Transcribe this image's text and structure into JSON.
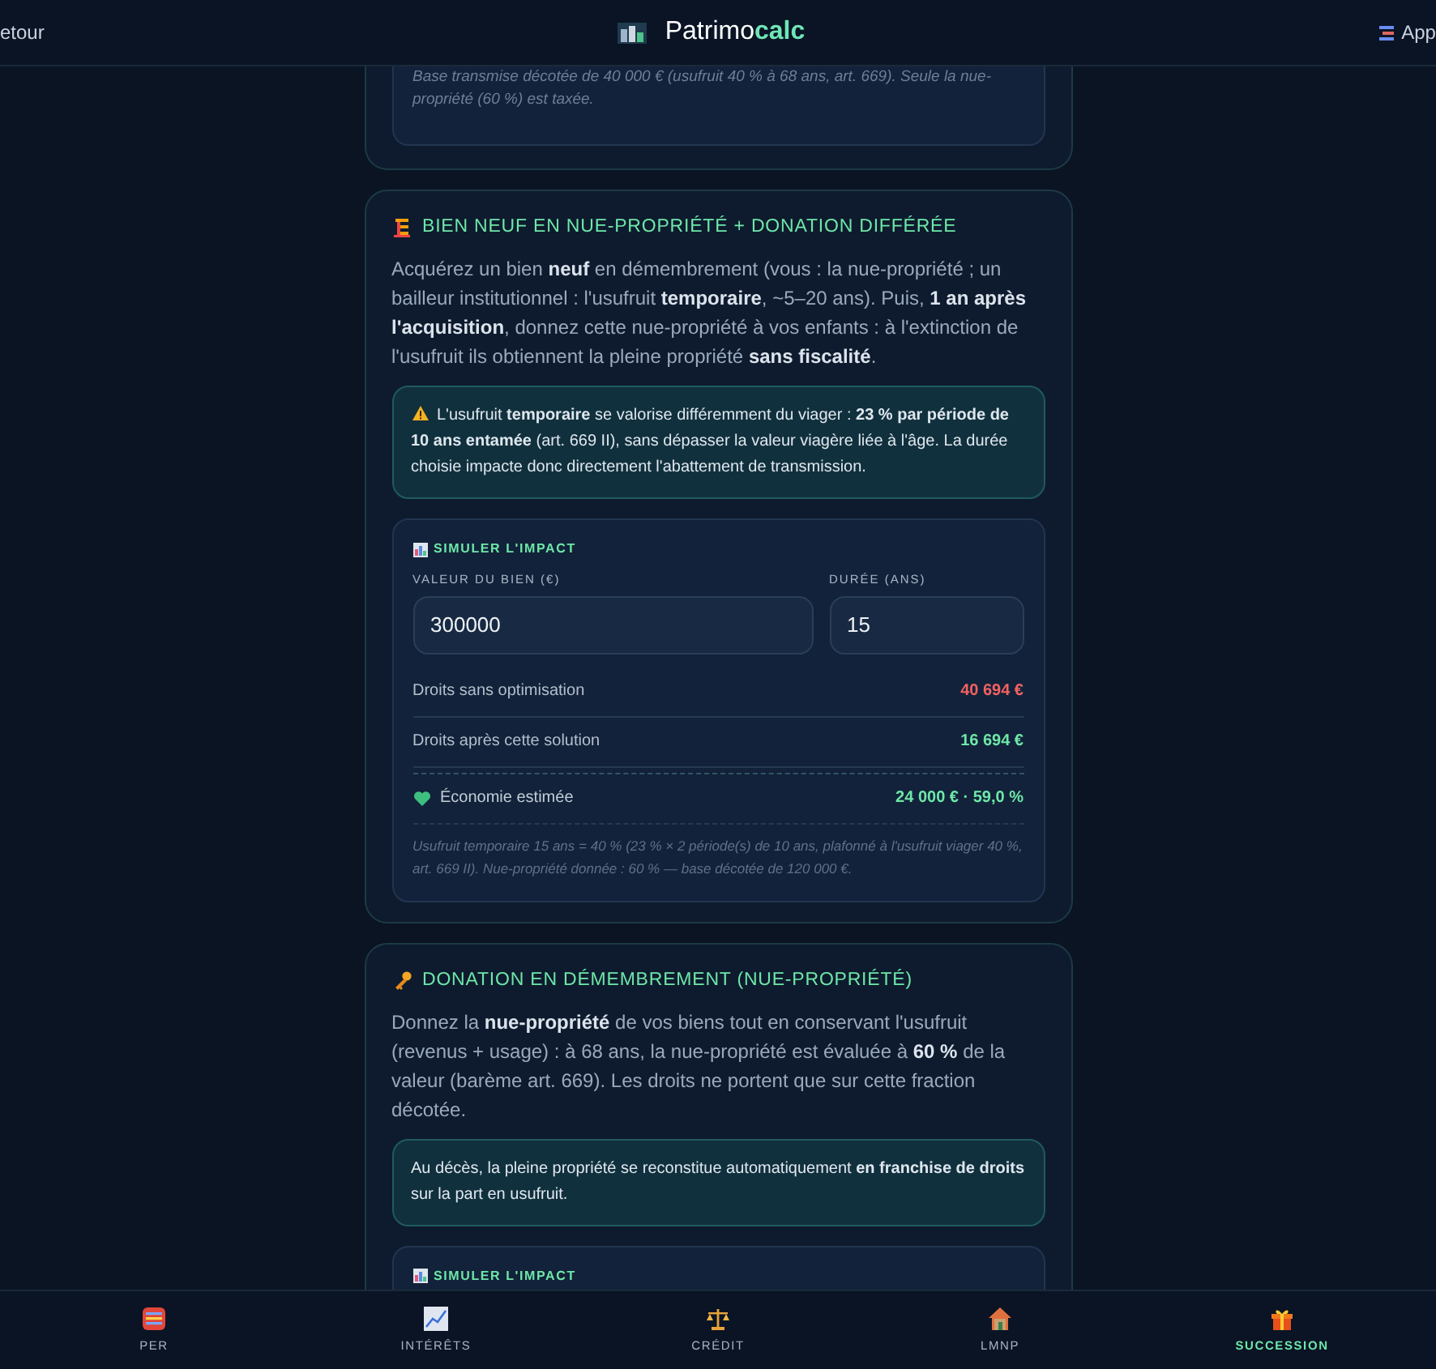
{
  "header": {
    "back_link": "etour",
    "title_main": "Patrimo",
    "title_accent": "calc",
    "apps_link": "App"
  },
  "cards": [
    {
      "kind": "fragment",
      "note": "Base transmise décotée de 40 000 € (usufruit 40 % à 68 ans, art. 669). Seule la nue-propriété (60 %) est taxée."
    },
    {
      "kind": "building",
      "title": "BIEN NEUF EN NUE-PROPRIÉTÉ + DONATION DIFFÉRÉE",
      "body": "Acquérez un bien **neuf** en démembrement (vous : la nue-propriété ; un bailleur institutionnel : l'usufruit **temporaire**, ~5–20 ans). Puis, **1 an après l'acquisition**, donnez cette nue-propriété à vos enfants : à l'extinction de l'usufruit ils obtiennent la pleine propriété **sans fiscalité**.",
      "callout": {
        "warning": true,
        "text": "L'usufruit **temporaire** se valorise différemment du viager : **23 % par période de 10 ans entamée** (art. 669 II), sans dépasser la valeur viagère liée à l'âge. La durée choisie impacte donc directement l'abattement de transmission."
      },
      "simulator": {
        "title": "SIMULER L'IMPACT",
        "fields": [
          {
            "label": "VALEUR DU BIEN (€)",
            "value": "300000"
          },
          {
            "label": "DURÉE (ANS)",
            "value": "15"
          }
        ],
        "results": [
          {
            "label": "Droits sans optimisation",
            "value": "40 694 €",
            "color": "#f26262"
          },
          {
            "label": "Droits après cette solution",
            "value": "16 694 €",
            "color": "#6ee7a8"
          }
        ],
        "savings": {
          "label": "Économie estimée",
          "value": "24 000 € · 59,0 %"
        },
        "note": "Usufruit temporaire 15 ans = 40 % (23 % × 2 période(s) de 10 ans, plafonné à l'usufruit viager 40 %, art. 669 II). Nue-propriété donnée : 60 % — base décotée de 120 000 €."
      }
    },
    {
      "kind": "key",
      "title": "DONATION EN DÉMEMBREMENT (NUE-PROPRIÉTÉ)",
      "body": "Donnez la **nue-propriété** de vos biens tout en conservant l'usufruit (revenus + usage) : à 68 ans, la nue-propriété est évaluée à **60 %** de la valeur (barème art. 669). Les droits ne portent que sur cette fraction décotée.",
      "callout": {
        "warning": false,
        "text": "Au décès, la pleine propriété se reconstitue automatiquement **en franchise de droits** sur la part en usufruit."
      },
      "simulator": {
        "title": "SIMULER L'IMPACT"
      }
    }
  ],
  "nav": [
    {
      "kind": "per",
      "label": "PER",
      "selected": false
    },
    {
      "kind": "interest",
      "label": "INTÉRÊTS",
      "selected": false
    },
    {
      "kind": "credit",
      "label": "CRÉDIT",
      "selected": false
    },
    {
      "kind": "lmnp",
      "label": "LMNP",
      "selected": false
    },
    {
      "kind": "succession",
      "label": "SUCCESSION",
      "selected": true
    }
  ]
}
